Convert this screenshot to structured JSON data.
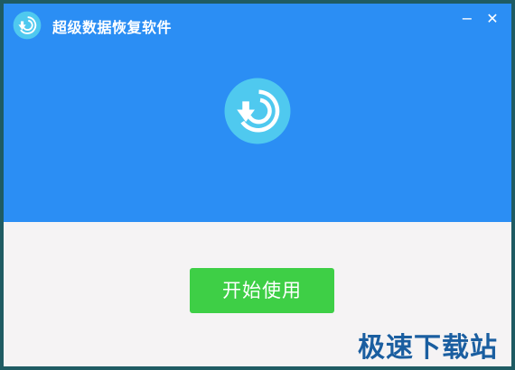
{
  "window": {
    "title": "超级数据恢复软件",
    "minimize_label": "−",
    "close_label": "✕"
  },
  "icons": {
    "app_logo": "restore-logo-icon",
    "hero_logo": "restore-logo-icon"
  },
  "main": {
    "start_button_label": "开始使用"
  },
  "watermark": {
    "text": "极速下载站"
  },
  "colors": {
    "header_blue": "#2b8ef4",
    "body_bg": "#f5f3f4",
    "button_green": "#3ecf46",
    "logo_circle": "#4fc9ef",
    "window_border": "#1f5b63",
    "watermark": "#1a5ea0"
  }
}
